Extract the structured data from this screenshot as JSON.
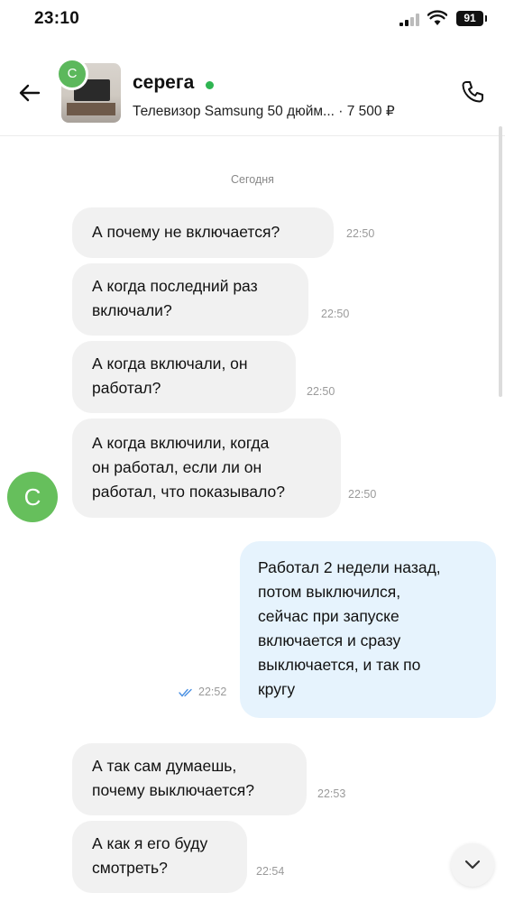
{
  "status_bar": {
    "time": "23:10",
    "battery": "91"
  },
  "header": {
    "contact_name": "серега",
    "avatar_initial": "С",
    "listing_title": "Телевизор Samsung 50 дюйм... · 7 500 ₽",
    "icons": {
      "back": "arrow-left-icon",
      "call": "phone-icon"
    },
    "online_color": "#2fb552"
  },
  "chat": {
    "date_label": "Сегодня",
    "sender_avatar_initial": "С",
    "messages": [
      {
        "direction": "incoming",
        "lines": [
          "А почему не включается?"
        ],
        "time": "22:50"
      },
      {
        "direction": "incoming",
        "lines": [
          "А когда последний раз",
          "включали?"
        ],
        "time": "22:50"
      },
      {
        "direction": "incoming",
        "lines": [
          "А когда включали, он",
          "работал?"
        ],
        "time": "22:50"
      },
      {
        "direction": "incoming",
        "lines": [
          "А когда включили, когда",
          "он работал, если ли он",
          "работал, что показывало?"
        ],
        "time": "22:50"
      },
      {
        "direction": "outgoing",
        "lines": [
          "Работал 2 недели назад,",
          "потом выключился,",
          "сейчас при запуске",
          "включается и сразу",
          "выключается, и так по",
          "кругу"
        ],
        "time": "22:52",
        "status": "read"
      },
      {
        "direction": "incoming",
        "lines": [
          "А так сам думаешь,",
          "почему выключается?"
        ],
        "time": "22:53"
      },
      {
        "direction": "incoming",
        "lines": [
          "А как я его буду",
          "смотреть?"
        ],
        "time": "22:54"
      }
    ]
  },
  "colors": {
    "incoming_bubble": "#f1f1f1",
    "outgoing_bubble": "#e6f3fd",
    "avatar_green": "#66bf5c",
    "read_check": "#4a90e2"
  }
}
